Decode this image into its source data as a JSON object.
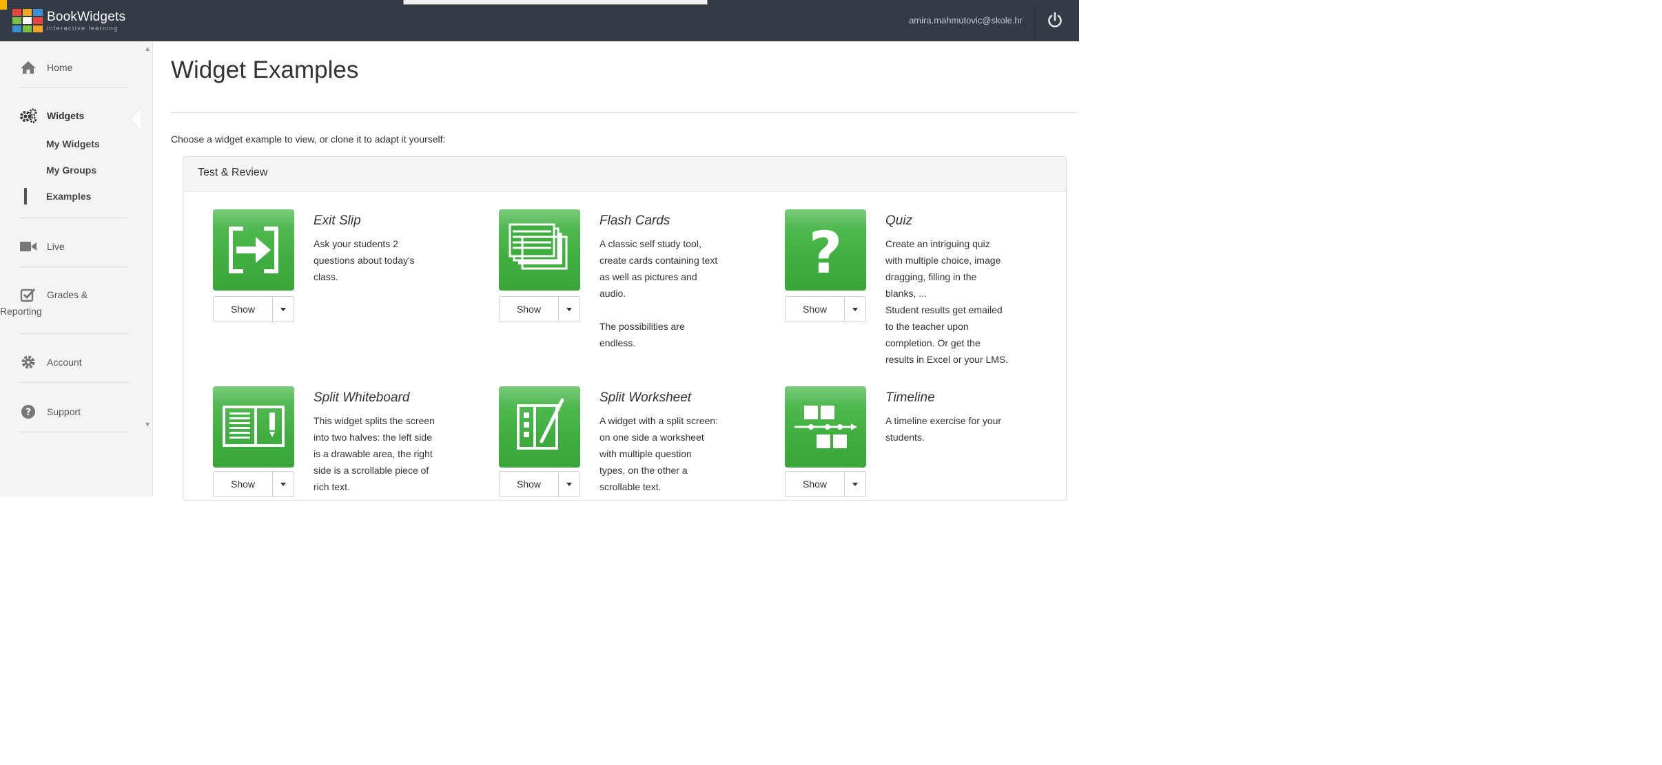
{
  "header": {
    "brand_name": "BookWidgets",
    "brand_tagline": "interactive learning",
    "user_email": "amira.mahmutovic@skole.hr",
    "power_icon": "power-icon"
  },
  "sidebar": {
    "items": [
      {
        "label": "Home",
        "icon": "home-icon"
      },
      {
        "label": "Widgets",
        "icon": "gears-icon"
      },
      {
        "label": "Live",
        "icon": "video-camera-icon"
      },
      {
        "label": "Grades &",
        "label2": "Reporting",
        "icon": "checkbox-icon"
      },
      {
        "label": "Account",
        "icon": "gear-icon"
      },
      {
        "label": "Support",
        "icon": "question-circle-icon"
      }
    ],
    "widgets_sub": [
      "My Widgets",
      "My Groups",
      "Examples"
    ],
    "active_sub": "Examples"
  },
  "main": {
    "title": "Widget Examples",
    "intro": "Choose a widget example to view, or clone it to adapt it yourself:",
    "section_title": "Test & Review",
    "show_label": "Show",
    "cards": [
      {
        "name": "Exit Slip",
        "icon": "exit-arrow-icon",
        "description": "Ask your students 2\nquestions about today's\nclass."
      },
      {
        "name": "Flash Cards",
        "icon": "flash-cards-icon",
        "description": "A classic self study tool,\ncreate cards containing text\nas well as pictures and\naudio.\n\nThe possibilities are\nendless."
      },
      {
        "name": "Quiz",
        "icon": "question-mark-icon",
        "description": "Create an intriguing quiz\nwith multiple choice, image\ndragging, filling in the\nblanks, ...\nStudent results get emailed\nto the teacher upon\ncompletion. Or get the\nresults in Excel or your LMS."
      },
      {
        "name": "Split Whiteboard",
        "icon": "split-whiteboard-icon",
        "description": "This widget splits the screen\ninto two halves: the left side\nis a drawable area, the right\nside is a scrollable piece of\nrich text."
      },
      {
        "name": "Split Worksheet",
        "icon": "split-worksheet-icon",
        "description": "A widget with a split screen:\non one side a worksheet\nwith multiple question\ntypes, on the other a\nscrollable text."
      },
      {
        "name": "Timeline",
        "icon": "timeline-icon",
        "description": "A timeline exercise for your\nstudents."
      }
    ]
  },
  "colors": {
    "topbar": "#333c44",
    "tile_green": "#46b346",
    "sidebar_bg": "#f4f4f4"
  }
}
